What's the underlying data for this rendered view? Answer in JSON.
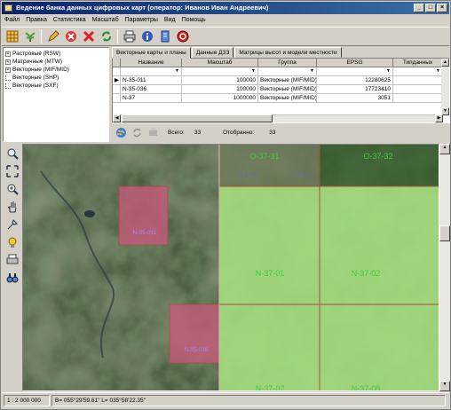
{
  "window": {
    "title": "Ведение банка данных цифровых карт (оператор: Иванов Иван Андреевич)",
    "buttons": [
      "_",
      "□",
      "×"
    ]
  },
  "menu": [
    "Файл",
    "Правка",
    "Статистика",
    "Масштаб",
    "Параметры",
    "Вид",
    "Помощь"
  ],
  "toolbar": {
    "icons": [
      "grid-icon",
      "plant-icon",
      "edit-icon",
      "cancel-icon",
      "delete-icon",
      "refresh-icon",
      "print-icon",
      "info-icon",
      "bookmark-icon",
      "stop-icon"
    ]
  },
  "tree": {
    "items": [
      {
        "label": "Растровые (RSW)",
        "expandable": true
      },
      {
        "label": "Матричные (MTW)",
        "expandable": true
      },
      {
        "label": "Векторные (MIF/MID)",
        "expandable": true
      },
      {
        "label": "Векторные (SHP)",
        "expandable": false
      },
      {
        "label": "Векторные (SXF)",
        "expandable": false
      }
    ]
  },
  "tabs": [
    "Векторные карты и планы",
    "Данные ДЗЗ",
    "Матрицы высот и модели местности"
  ],
  "grid": {
    "columns": [
      "Название",
      "Масштаб",
      "Группа",
      "EPSG",
      "Типданных"
    ],
    "rows": [
      {
        "name": "N-35-011",
        "scale": "100000",
        "group": "Векторные (MIF/MID)",
        "epsg": "12280625",
        "current": true
      },
      {
        "name": "N-35-036",
        "scale": "100000",
        "group": "Векторные (MIF/MID)",
        "epsg": "17723410",
        "current": false
      },
      {
        "name": "N-37",
        "scale": "1000000",
        "group": "Векторные (MIF/MID)",
        "epsg": "3051",
        "current": false
      }
    ]
  },
  "summary": {
    "total_label": "Всего:",
    "total_value": "33",
    "filtered_label": "Отобранно:",
    "filtered_value": "33"
  },
  "map": {
    "labels": [
      "O-37-31",
      "O-37-32",
      "N-35-011",
      "N-37-01",
      "N-37-02",
      "N-35-036",
      "N-37-07",
      "N-37-08"
    ],
    "small_labels": [
      "N-37-01",
      "N-37-01"
    ],
    "colors": {
      "green_overlay": "#9bd07a",
      "dark_overlay": "#5a6b4a",
      "pink_overlay": "#c65a7a",
      "grid_line": "#b24a3a"
    }
  },
  "vtools": [
    "zoom-in-icon",
    "fit-icon",
    "zoom-extent-icon",
    "pan-hand-icon",
    "pick-icon",
    "bulb-icon",
    "print-icon",
    "binoculars-icon"
  ],
  "statusbar": {
    "scale": "1 : 2 000 000",
    "coords": "B= 055°29'59.61\" L= 035°58'22.35\""
  }
}
